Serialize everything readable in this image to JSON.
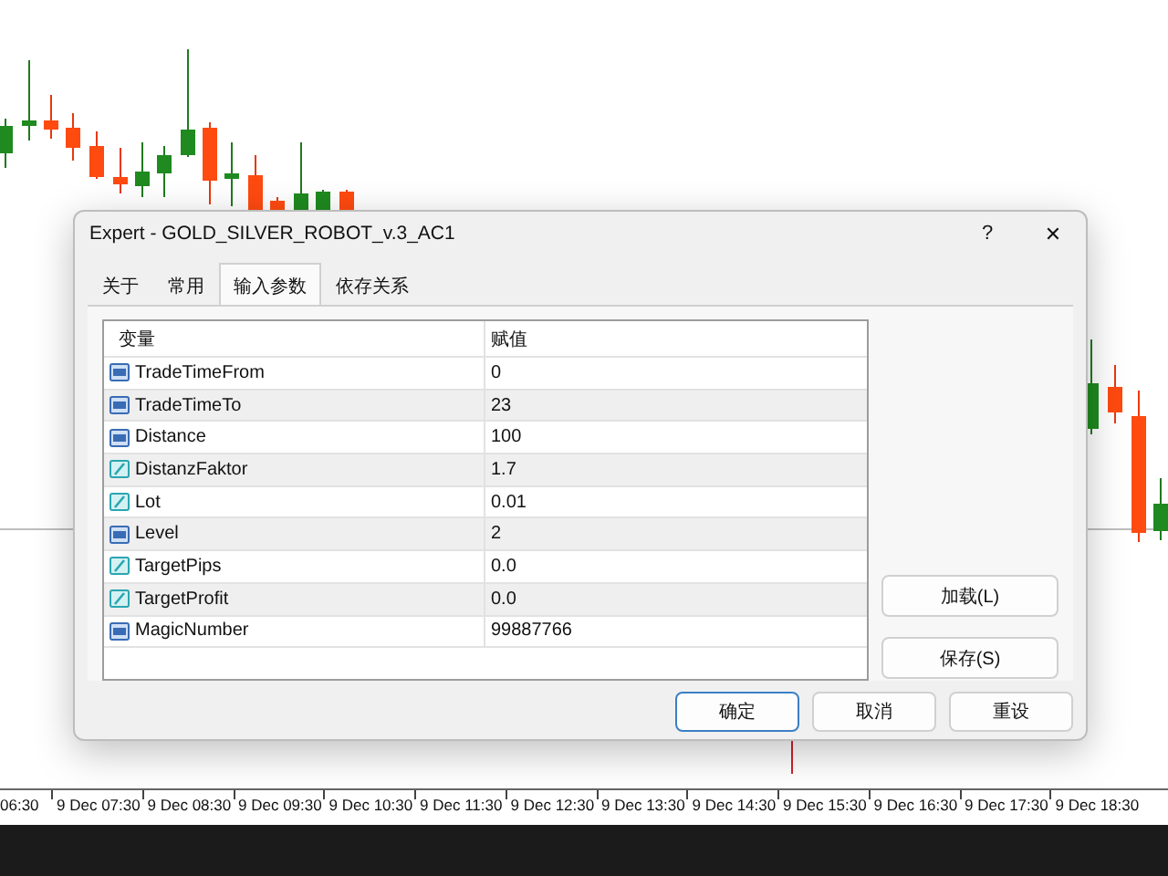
{
  "dialog": {
    "title": "Expert - GOLD_SILVER_ROBOT_v.3_AC1",
    "help": "?",
    "close": "✕"
  },
  "tabs": [
    {
      "label": "关于",
      "selected": false
    },
    {
      "label": "常用",
      "selected": false
    },
    {
      "label": "输入参数",
      "selected": true
    },
    {
      "label": "依存关系",
      "selected": false
    }
  ],
  "table": {
    "columns": [
      "变量",
      "赋值"
    ],
    "rows": [
      {
        "kind": "int",
        "name": "TradeTimeFrom",
        "value": "0"
      },
      {
        "kind": "int",
        "name": "TradeTimeTo",
        "value": "23"
      },
      {
        "kind": "int",
        "name": "Distance",
        "value": "100"
      },
      {
        "kind": "double",
        "name": "DistanzFaktor",
        "value": "1.7"
      },
      {
        "kind": "double",
        "name": "Lot",
        "value": "0.01"
      },
      {
        "kind": "int",
        "name": "Level",
        "value": "2"
      },
      {
        "kind": "double",
        "name": "TargetPips",
        "value": "0.0"
      },
      {
        "kind": "double",
        "name": "TargetProfit",
        "value": "0.0"
      },
      {
        "kind": "int",
        "name": "MagicNumber",
        "value": "99887766"
      }
    ]
  },
  "side_buttons": [
    "加载(L)",
    "保存(S)"
  ],
  "footer_buttons": [
    {
      "label": "确定",
      "default": true
    },
    {
      "label": "取消",
      "default": false
    },
    {
      "label": "重设",
      "default": false
    }
  ],
  "time_axis": [
    "06:30",
    "9 Dec 07:30",
    "9 Dec 08:30",
    "9 Dec 09:30",
    "9 Dec 10:30",
    "9 Dec 11:30",
    "9 Dec 12:30",
    "9 Dec 13:30",
    "9 Dec 14:30",
    "9 Dec 15:30",
    "9 Dec 16:30",
    "9 Dec 17:30",
    "9 Dec 18:30"
  ]
}
